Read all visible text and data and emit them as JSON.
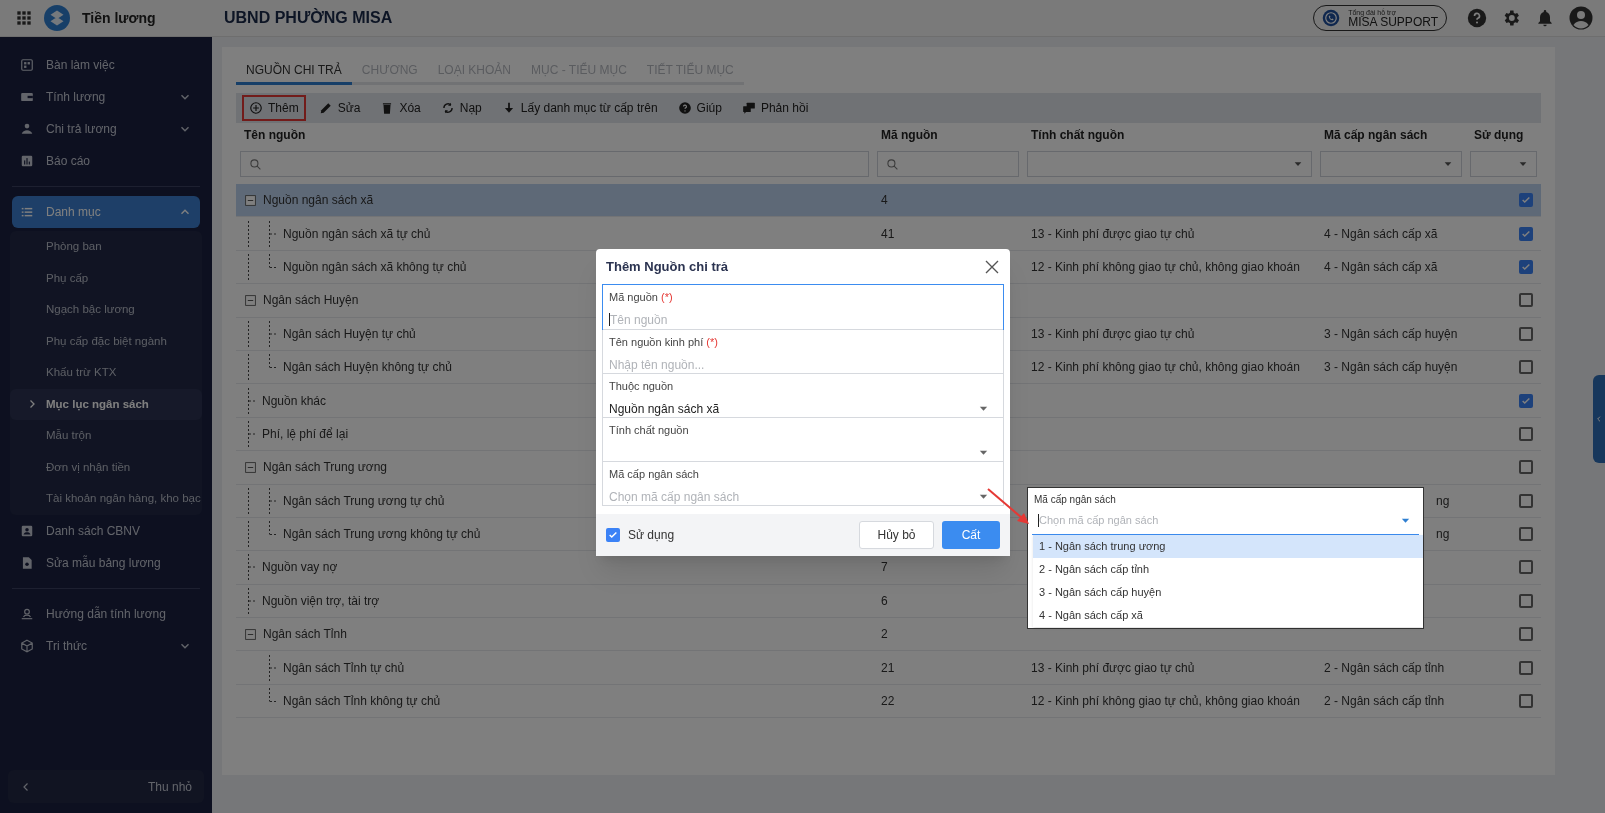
{
  "app": {
    "title": "Tiền lương",
    "org": "UBND PHƯỜNG MISA"
  },
  "support": {
    "caption": "Tổng đài hỗ trợ",
    "label": "MISA SUPPORT"
  },
  "sidebar": {
    "sections": [
      [
        {
          "label": "Bàn làm việc",
          "selected": false
        },
        {
          "label": "Tính lương",
          "expanded": false,
          "selected": false
        },
        {
          "label": "Chi trả lương",
          "expanded": false,
          "selected": false
        },
        {
          "label": "Báo cáo",
          "selected": false
        }
      ],
      [
        {
          "label": "Danh mục",
          "expanded": true,
          "selected": true,
          "children": [
            {
              "label": "Phòng ban",
              "selected": false
            },
            {
              "label": "Phụ cấp",
              "selected": false
            },
            {
              "label": "Ngạch bậc lương",
              "selected": false
            },
            {
              "label": "Phụ cấp đặc biệt ngành",
              "selected": false
            },
            {
              "label": "Khấu trừ KTX",
              "selected": false
            },
            {
              "label": "Mục lục ngân sách",
              "selected": true
            },
            {
              "label": "Mẫu trộn",
              "selected": false
            },
            {
              "label": "Đơn vị nhận tiền",
              "selected": false
            },
            {
              "label": "Tài khoản ngân hàng, kho bạc",
              "selected": false
            }
          ]
        },
        {
          "label": "Danh sách CBNV",
          "selected": false
        },
        {
          "label": "Sửa mẫu bảng lương",
          "selected": false
        }
      ],
      [
        {
          "label": "Hướng dẫn tính lương",
          "selected": false
        },
        {
          "label": "Tri thức",
          "expanded": false,
          "selected": false
        }
      ]
    ],
    "collapse": {
      "label": "Thu nhỏ"
    }
  },
  "tabs": [
    {
      "label": "NGUỒN CHI TRẢ",
      "selected": true
    },
    {
      "label": "CHƯƠNG",
      "selected": false
    },
    {
      "label": "LOẠI KHOẢN",
      "selected": false
    },
    {
      "label": "MỤC - TIỂU MỤC",
      "selected": false
    },
    {
      "label": "TIẾT TIỂU MỤC",
      "selected": false
    }
  ],
  "toolbar": [
    {
      "label": "Thêm",
      "highlighted": true
    },
    {
      "label": "Sửa",
      "highlighted": false
    },
    {
      "label": "Xóa",
      "highlighted": false
    },
    {
      "label": "Nạp",
      "highlighted": false
    },
    {
      "label": "Lấy danh mục từ cấp trên",
      "highlighted": false
    },
    {
      "label": "Giúp",
      "highlighted": false
    },
    {
      "label": "Phản hồi",
      "highlighted": false
    }
  ],
  "table": {
    "columns": [
      "Tên nguồn",
      "Mã nguồn",
      "Tính chất nguồn",
      "Mã cấp ngân sách",
      "Sử dụng"
    ],
    "filters": [
      {
        "kind": "search"
      },
      {
        "kind": "search"
      },
      {
        "kind": "select"
      },
      {
        "kind": "select"
      },
      {
        "kind": "select"
      }
    ],
    "rows": [
      {
        "name": "Nguồn ngân sách xã",
        "code": "4",
        "used": true,
        "selected": true,
        "expanded": true,
        "children": [
          {
            "name": "Nguồn ngân sách xã tự chủ",
            "code": "41",
            "nature": "13 - Kinh phí được giao tự chủ",
            "level": "4 - Ngân sách cấp xã",
            "used": true,
            "selected": false
          },
          {
            "name": "Nguồn ngân sách xã không tự chủ",
            "nature": "12 - Kinh phí không giao tự chủ, không giao khoán",
            "level": "4 - Ngân sách cấp xã",
            "used": true,
            "selected": false
          }
        ]
      },
      {
        "name": "Ngân sách Huyện",
        "used": false,
        "selected": false,
        "expanded": true,
        "children": [
          {
            "name": "Ngân sách Huyện tự chủ",
            "nature": "13 - Kinh phí được giao tự chủ",
            "level": "3 - Ngân sách cấp huyện",
            "used": false,
            "selected": false
          },
          {
            "name": "Ngân sách Huyện không tự chủ",
            "nature": "12 - Kinh phí không giao tự chủ, không giao khoán",
            "level": "3 - Ngân sách cấp huyện",
            "used": false,
            "selected": false
          }
        ]
      },
      {
        "name": "Nguồn khác",
        "used": true,
        "selected": false
      },
      {
        "name": "Phí, lệ phí để lại",
        "used": false,
        "selected": false
      },
      {
        "name": "Ngân sách Trung ương",
        "used": false,
        "selected": false,
        "expanded": true,
        "children": [
          {
            "name": "Ngân sách Trung ương tự chủ",
            "level": "ng",
            "level_clipped": true,
            "used": false,
            "selected": false
          },
          {
            "name": "Ngân sách Trung ương không tự chủ",
            "level": "ng",
            "level_clipped": true,
            "used": false,
            "selected": false
          }
        ]
      },
      {
        "name": "Nguồn vay nợ",
        "code": "7",
        "used": false,
        "selected": false
      },
      {
        "name": "Nguồn viện trợ, tài trợ",
        "code": "6",
        "used": false,
        "selected": false
      },
      {
        "name": "Ngân sách Tỉnh",
        "code": "2",
        "used": false,
        "selected": false,
        "expanded": true,
        "children": [
          {
            "name": "Ngân sách Tỉnh tự chủ",
            "code": "21",
            "nature": "13 - Kinh phí được giao tự chủ",
            "level": "2 - Ngân sách cấp tỉnh",
            "used": false,
            "selected": false
          },
          {
            "name": "Ngân sách Tỉnh không tự chủ",
            "code": "22",
            "nature": "12 - Kinh phí không giao tự chủ, không giao khoán",
            "level": "2 - Ngân sách cấp tỉnh",
            "used": false,
            "selected": false
          }
        ]
      }
    ]
  },
  "dialog": {
    "title": "Thêm Nguồn chi trả",
    "fields": [
      {
        "kind": "text",
        "label": "Mã nguồn",
        "required_mark": "(*)",
        "placeholder": "Tên nguồn",
        "focused": true
      },
      {
        "kind": "text",
        "label": "Tên nguồn kinh phí",
        "required_mark": "(*)",
        "placeholder": "Nhập tên nguồn...",
        "focused": false
      },
      {
        "kind": "select",
        "label": "Thuộc nguồn",
        "value": "Nguồn ngân sách xã",
        "focused": false
      },
      {
        "kind": "select",
        "label": "Tính chất nguồn",
        "focused": false
      },
      {
        "kind": "select",
        "label": "Mã cấp ngân sách",
        "placeholder": "Chọn mã cấp ngân sách",
        "focused": false
      }
    ],
    "use": {
      "label": "Sử dụng",
      "checked": true
    },
    "buttons": [
      {
        "label": "Hủy bỏ",
        "kind": "secondary"
      },
      {
        "label": "Cất",
        "kind": "primary"
      }
    ]
  },
  "dropdown": {
    "label": "Mã cấp ngân sách",
    "placeholder": "Chọn mã cấp ngân sách",
    "options": [
      {
        "label": "1 - Ngân sách trung ương",
        "selected": true
      },
      {
        "label": "2 - Ngân sách cấp tỉnh",
        "selected": false
      },
      {
        "label": "3 - Ngân sách cấp huyện",
        "selected": false
      },
      {
        "label": "4 - Ngân sách cấp xã",
        "selected": false
      }
    ]
  }
}
